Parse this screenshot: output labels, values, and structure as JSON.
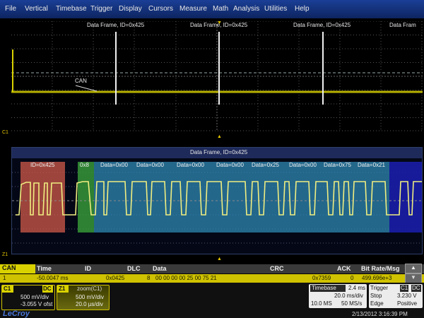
{
  "menu": [
    "File",
    "Vertical",
    "Timebase",
    "Trigger",
    "Display",
    "Cursors",
    "Measure",
    "Math",
    "Analysis",
    "Utilities",
    "Help"
  ],
  "upper": {
    "frame_labels": [
      "Data Frame, ID=0x425",
      "Data Frame, ID=0x425",
      "Data Frame, ID=0x425",
      "Data Fram"
    ],
    "trace_label": "CAN",
    "channel_marker": "C1"
  },
  "zoom": {
    "title": "Data Frame, ID=0x425",
    "fields": [
      "ID=0x425",
      "0x8",
      "Data=0x00",
      "Data=0x00",
      "Data=0x00",
      "Data=0x00",
      "Data=0x25",
      "Data=0x00",
      "Data=0x75",
      "Data=0x21"
    ],
    "channel_marker": "Z1"
  },
  "table": {
    "headers": [
      "CAN",
      "Time",
      "ID",
      "DLC",
      "Data",
      "CRC",
      "ACK",
      "Bit Rate/Msg"
    ],
    "row": {
      "index": "1",
      "time": "-50.0047 ms",
      "id": "0x0425",
      "dlc": "8",
      "data": "00 00 00 00 25 00 75 21",
      "crc": "0x7359",
      "ack": "0",
      "bitrate": "499.696e+3"
    }
  },
  "channel": {
    "name": "C1",
    "coupling": "DC",
    "vdiv": "500 mV/div",
    "offset": "-3.055 V ofst"
  },
  "zoomtile": {
    "name": "Z1",
    "title": "zoom(C1)",
    "vdiv": "500 mV/div",
    "tdiv": "20.0 µs/div"
  },
  "timebase": {
    "label": "Timebase",
    "delay": "2.4 ms",
    "tdiv": "20.0 ms/div",
    "samples": "10.0 MS",
    "rate": "50 MS/s"
  },
  "trigger": {
    "label": "Trigger",
    "channel": "C1",
    "coupling": "DC",
    "mode": "Stop",
    "level": "3.230 V",
    "type": "Edge",
    "slope": "Positive"
  },
  "brand": "LeCroy",
  "datetime": "2/13/2012 3:16:39 PM",
  "colors": {
    "trace": "#d9d200",
    "id_field": "#d05a4a",
    "dlc_field": "#39a03a",
    "data_field": "#2f8cb8",
    "eof_field": "#1a1ea8",
    "menubar": "#1b3f96"
  }
}
